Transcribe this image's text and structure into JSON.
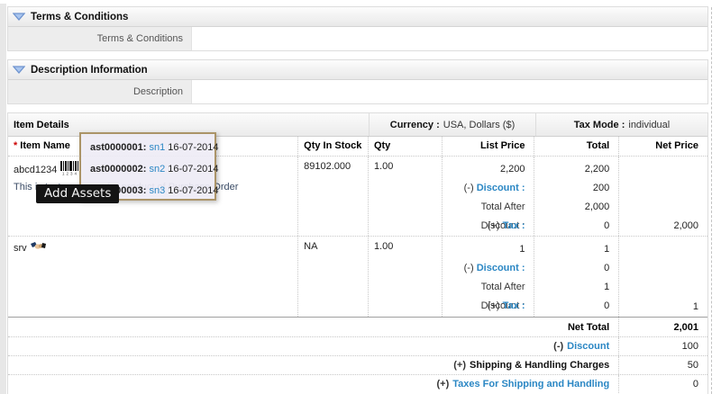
{
  "sections": [
    {
      "title": "Terms & Conditions",
      "field_label": "Terms & Conditions",
      "field_value": ""
    },
    {
      "title": "Description Information",
      "field_label": "Description",
      "field_value": ""
    }
  ],
  "item_details": {
    "title": "Item Details",
    "currency_label": "Currency :",
    "currency_value": "USA, Dollars ($)",
    "tax_mode_label": "Tax Mode :",
    "tax_mode_value": "individual",
    "required_marker": "*",
    "columns": [
      "Item Name",
      "Qty In Stock",
      "Qty",
      "List Price",
      "Total",
      "Net Price"
    ],
    "rows": [
      {
        "name": "abcd1234",
        "barcode_digits": "1234",
        "comment": "This is test comment for product of Purchase Order",
        "qty_in_stock": "89102.000",
        "qty": "1.00",
        "list_price": "2,200",
        "total": "2,200",
        "discount_prefix": "(-)",
        "discount_label": "Discount :",
        "discount_value": "200",
        "after_discount_label": "Total After Discount :",
        "after_discount_value": "2,000",
        "tax_prefix": "(+)",
        "tax_label": "Tax :",
        "tax_value": "0",
        "net_price": "2,000"
      },
      {
        "name": "srv",
        "qty_in_stock": "NA",
        "qty": "1.00",
        "list_price": "1",
        "total": "1",
        "discount_prefix": "(-)",
        "discount_label": "Discount :",
        "discount_value": "0",
        "after_discount_label": "Total After Discount :",
        "after_discount_value": "1",
        "tax_prefix": "(+)",
        "tax_label": "Tax :",
        "tax_value": "0",
        "net_price": "1"
      }
    ],
    "summary": {
      "net_total_label": "Net Total",
      "net_total_value": "2,001",
      "rows": [
        {
          "prefix": "(-)",
          "label": "Discount",
          "value": "100"
        },
        {
          "prefix": "(+)",
          "label": "Shipping & Handling Charges",
          "value": "50"
        },
        {
          "prefix": "(+)",
          "label": "Taxes For Shipping and Handling",
          "value": "0"
        }
      ]
    }
  },
  "asset_tooltip": {
    "items": [
      {
        "id": "ast0000001:",
        "link": "sn1",
        "date": "16-07-2014"
      },
      {
        "id": "ast0000002:",
        "link": "sn2",
        "date": "16-07-2014"
      },
      {
        "id": "ast0000003:",
        "link": "sn3",
        "date": "16-07-2014"
      }
    ]
  },
  "add_assets_tooltip": "Add Assets",
  "colors": {
    "link_blue": "#2b87c4",
    "tooltip_border": "#ab9468",
    "required_red": "#cc0000"
  }
}
